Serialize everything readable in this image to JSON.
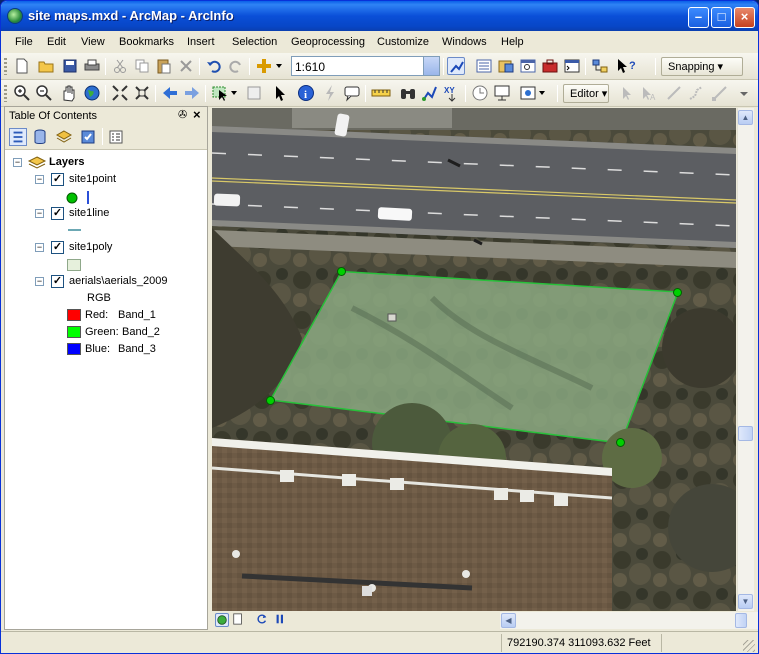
{
  "window": {
    "title": "site maps.mxd - ArcMap - ArcInfo"
  },
  "menubar": {
    "items": [
      "File",
      "Edit",
      "View",
      "Bookmarks",
      "Insert",
      "Selection",
      "Geoprocessing",
      "Customize",
      "Windows",
      "Help"
    ]
  },
  "toolbar": {
    "scale": "1:610",
    "snapping_label": "Snapping",
    "editor_label": "Editor"
  },
  "toc": {
    "title": "Table Of Contents",
    "layers_label": "Layers",
    "layers": [
      {
        "name": "site1point",
        "checked": true,
        "symbol": "green-point"
      },
      {
        "name": "site1line",
        "checked": true,
        "symbol": "teal-line"
      },
      {
        "name": "site1poly",
        "checked": true,
        "symbol": "pale-fill"
      },
      {
        "name": "aerials\\aerials_2009",
        "checked": true,
        "symbol": "rgb"
      }
    ],
    "rgb": {
      "label": "RGB",
      "bands": [
        {
          "channel": "Red:",
          "band": "Band_1",
          "color": "#ff0000"
        },
        {
          "channel": "Green:",
          "band": "Band_2",
          "color": "#00ff00"
        },
        {
          "channel": "Blue:",
          "band": "Band_3",
          "color": "#0000ff"
        }
      ]
    }
  },
  "status": {
    "coordinates": "792190.374  311093.632 Feet"
  },
  "colors": {
    "titlebar": "#0a4fd8",
    "selection_point": "#00d000",
    "polygon_outline": "#2ebd3a",
    "polygon_fill": "#8db08a"
  }
}
